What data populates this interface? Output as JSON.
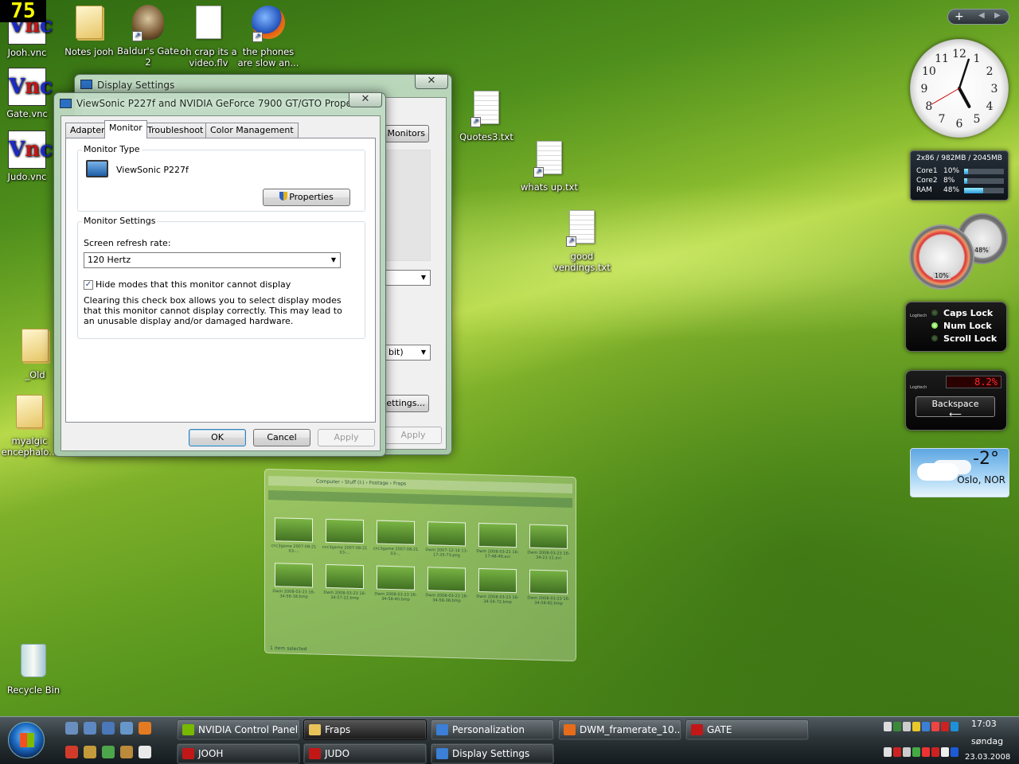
{
  "fps_counter": "75",
  "desktop_icons": [
    {
      "label": "Jooh.vnc"
    },
    {
      "label": "Notes jooh"
    },
    {
      "label": "Baldur's Gate 2"
    },
    {
      "label": "oh crap its a video.flv"
    },
    {
      "label": "the phones are slow an..."
    },
    {
      "label": "Gate.vnc"
    },
    {
      "label": "Judo.vnc"
    },
    {
      "label": "Quotes3.txt"
    },
    {
      "label": "whats up.txt"
    },
    {
      "label": "good vendings.txt"
    },
    {
      "label": "_Old"
    },
    {
      "label": "myalgic encephalo..."
    },
    {
      "label": "Recycle Bin"
    }
  ],
  "display_settings_window": {
    "title": "Display Settings",
    "monitors_button": "Monitors",
    "bits_dropdown_tail": "bit)",
    "settings_button_tail": "ettings...",
    "apply_button": "Apply"
  },
  "properties_dialog": {
    "title": "ViewSonic P227f and NVIDIA GeForce 7900 GT/GTO Properties",
    "tabs": [
      "Adapter",
      "Monitor",
      "Troubleshoot",
      "Color Management"
    ],
    "active_tab": "Monitor",
    "monitor_type_legend": "Monitor Type",
    "monitor_name": "ViewSonic P227f",
    "properties_button": "Properties",
    "monitor_settings_legend": "Monitor Settings",
    "refresh_label": "Screen refresh rate:",
    "refresh_value": "120 Hertz",
    "hide_modes_label": "Hide modes that this monitor cannot display",
    "hide_modes_checked": true,
    "warning_text": "Clearing this check box allows you to select display modes that this monitor cannot display correctly. This may lead to an unusable display and/or damaged hardware.",
    "ok": "OK",
    "cancel": "Cancel",
    "apply": "Apply"
  },
  "gadgets": {
    "meter_title": "2x86 / 982MB / 2045MB",
    "rows": [
      {
        "label": "Core1",
        "value": "10%",
        "fraction": 0.1
      },
      {
        "label": "Core2",
        "value": "8%",
        "fraction": 0.08
      },
      {
        "label": "RAM",
        "value": "48%",
        "fraction": 0.48
      }
    ],
    "gauge_cpu": "10%",
    "gauge_ram": "48%",
    "lock_brand": "Logitech",
    "locks": [
      {
        "label": "Caps Lock",
        "on": false
      },
      {
        "label": "Num Lock",
        "on": true
      },
      {
        "label": "Scroll Lock",
        "on": false
      }
    ],
    "lcd_value": "8.2%",
    "backspace_label": "Backspace",
    "weather_temp": "-2°",
    "weather_city": "Oslo, NOR",
    "clock_numbers": [
      "12",
      "1",
      "2",
      "3",
      "4",
      "5",
      "6",
      "7",
      "8",
      "9",
      "10",
      "11"
    ]
  },
  "taskbar": {
    "buttons": [
      {
        "label": "NVIDIA Control Panel",
        "color": "#76b900"
      },
      {
        "label": "Fraps",
        "color": "#e8c35a"
      },
      {
        "label": "Personalization",
        "color": "#3b7fd6"
      },
      {
        "label": "DWM_framerate_10...",
        "color": "#e66b1a"
      },
      {
        "label": "GATE",
        "color": "#c21717"
      },
      {
        "label": "JOOH",
        "color": "#c21717"
      },
      {
        "label": "JUDO",
        "color": "#c21717"
      },
      {
        "label": "Display Settings",
        "color": "#3b7fd6"
      }
    ],
    "time": "17:03",
    "day": "søndag",
    "date": "23.03.2008"
  },
  "aero_thumbnail": {
    "address": "Computer › Stuff (I:) › Footage › Fraps",
    "files": [
      "cnc3game 2007-08-21 03-...",
      "cnc3game 2007-08-21 03-...",
      "cnc3game 2007-08-21 03-...",
      "Dwm 2007-12-14 11-17-35-73.png",
      "Dwm 2008-03-21 16-17-48-49.avi",
      "Dwm 2008-03-23 16-34-21-11.avi",
      "Dwm 2008-03-23 16-34-56-18.bmp",
      "Dwm 2008-03-23 16-34-57-22.bmp",
      "Dwm 2008-03-23 16-34-58-40.bmp",
      "Dwm 2008-03-23 16-34-58-38.bmp",
      "Dwm 2008-03-23 16-34-56-72.bmp",
      "Dwm 2008-03-23 16-34-58-82.bmp"
    ],
    "status": "1 item selected"
  }
}
